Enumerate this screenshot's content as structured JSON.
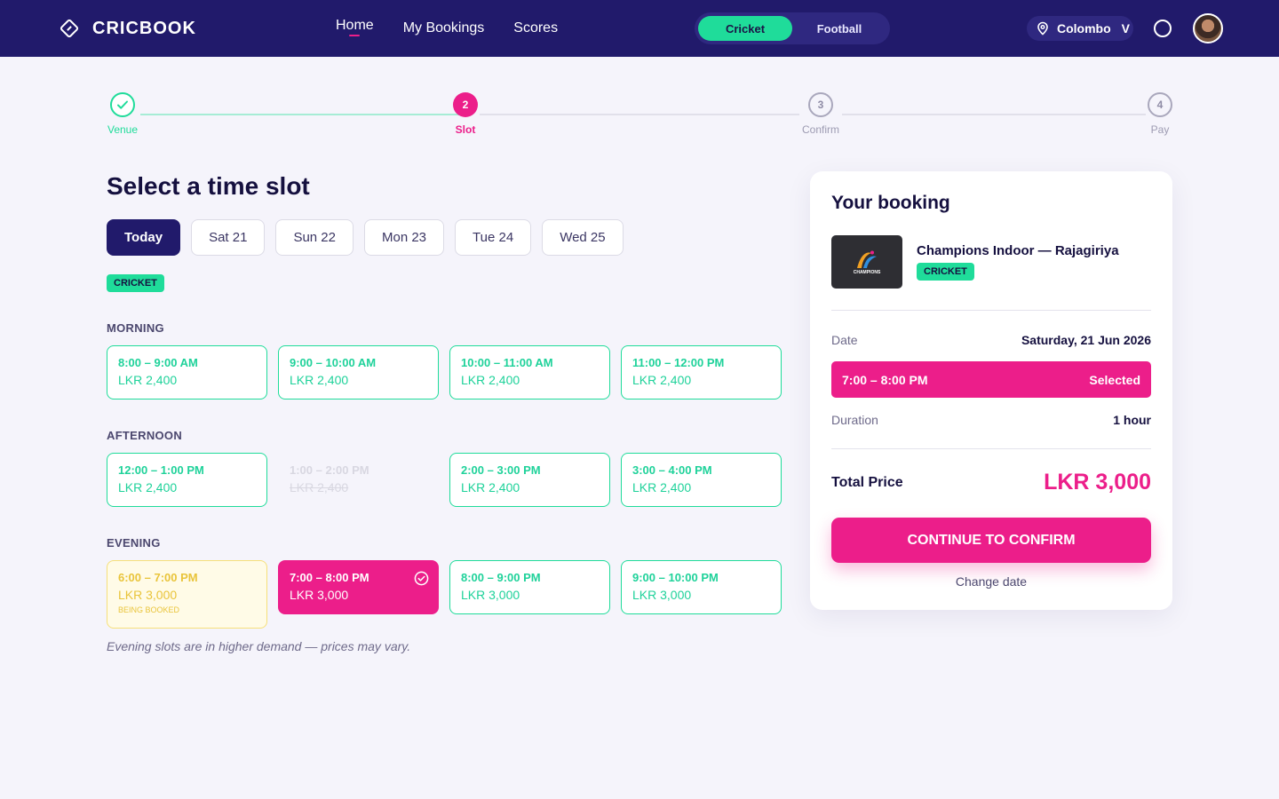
{
  "header": {
    "logo_text": "CRICBOOK",
    "nav": [
      "Home",
      "My Bookings",
      "Scores"
    ],
    "active_nav": "Home",
    "sports": [
      "Cricket",
      "Football"
    ],
    "active_sport": "Cricket",
    "location": "Colombo",
    "location_chevron": "V"
  },
  "stepper": {
    "steps": [
      {
        "number": "1",
        "label": "Venue",
        "status": "done"
      },
      {
        "number": "2",
        "label": "Slot",
        "status": "current"
      },
      {
        "number": "3",
        "label": "Confirm",
        "status": "todo"
      },
      {
        "number": "4",
        "label": "Pay",
        "status": "todo"
      }
    ]
  },
  "main": {
    "title": "Select a time slot",
    "dates": [
      "Today",
      "Sat 21",
      "Sun 22",
      "Mon 23",
      "Tue 24",
      "Wed 25"
    ],
    "active_date": "Today",
    "sport_tag": "CRICKET",
    "sections": [
      {
        "title": "MORNING",
        "slots": [
          {
            "time": "8:00 – 9:00 AM",
            "price": "LKR 2,400",
            "status": "available"
          },
          {
            "time": "9:00 – 10:00 AM",
            "price": "LKR 2,400",
            "status": "available"
          },
          {
            "time": "10:00 – 11:00 AM",
            "price": "LKR 2,400",
            "status": "available"
          },
          {
            "time": "11:00 – 12:00 PM",
            "price": "LKR 2,400",
            "status": "available"
          }
        ]
      },
      {
        "title": "AFTERNOON",
        "slots": [
          {
            "time": "12:00 – 1:00 PM",
            "price": "LKR 2,400",
            "status": "available"
          },
          {
            "time": "1:00 – 2:00 PM",
            "price": "LKR 2,400",
            "status": "unavailable"
          },
          {
            "time": "2:00 – 3:00 PM",
            "price": "LKR 2,400",
            "status": "available"
          },
          {
            "time": "3:00 – 4:00 PM",
            "price": "LKR 2,400",
            "status": "available"
          }
        ]
      },
      {
        "title": "EVENING",
        "slots": [
          {
            "time": "6:00 – 7:00 PM",
            "price": "LKR 3,000",
            "status": "being-booked",
            "note": "BEING BOOKED"
          },
          {
            "time": "7:00 – 8:00 PM",
            "price": "LKR 3,000",
            "status": "selected"
          },
          {
            "time": "8:00 – 9:00 PM",
            "price": "LKR 3,000",
            "status": "available"
          },
          {
            "time": "9:00 – 10:00 PM",
            "price": "LKR 3,000",
            "status": "available"
          }
        ]
      }
    ],
    "footnote": "Evening slots are in higher demand — prices may vary."
  },
  "booking": {
    "title": "Your booking",
    "venue_name": "Champions Indoor — Rajagiriya",
    "venue_tag": "CRICKET",
    "thumb_label": "CHAMPIONS",
    "date_label": "Date",
    "date_value": "Saturday, 21 Jun 2026",
    "selected_time": "7:00 – 8:00 PM",
    "selected_label": "Selected",
    "duration_label": "Duration",
    "duration_value": "1 hour",
    "total_label": "Total Price",
    "total_value": "LKR 3,000",
    "cta": "CONTINUE TO CONFIRM",
    "change_date": "Change date"
  },
  "colors": {
    "navy": "#211a6b",
    "accent_pink": "#ec1e8a",
    "accent_green": "#1fdc9a",
    "pending_yellow": "#e9c43a",
    "background": "#f5f4fb"
  }
}
